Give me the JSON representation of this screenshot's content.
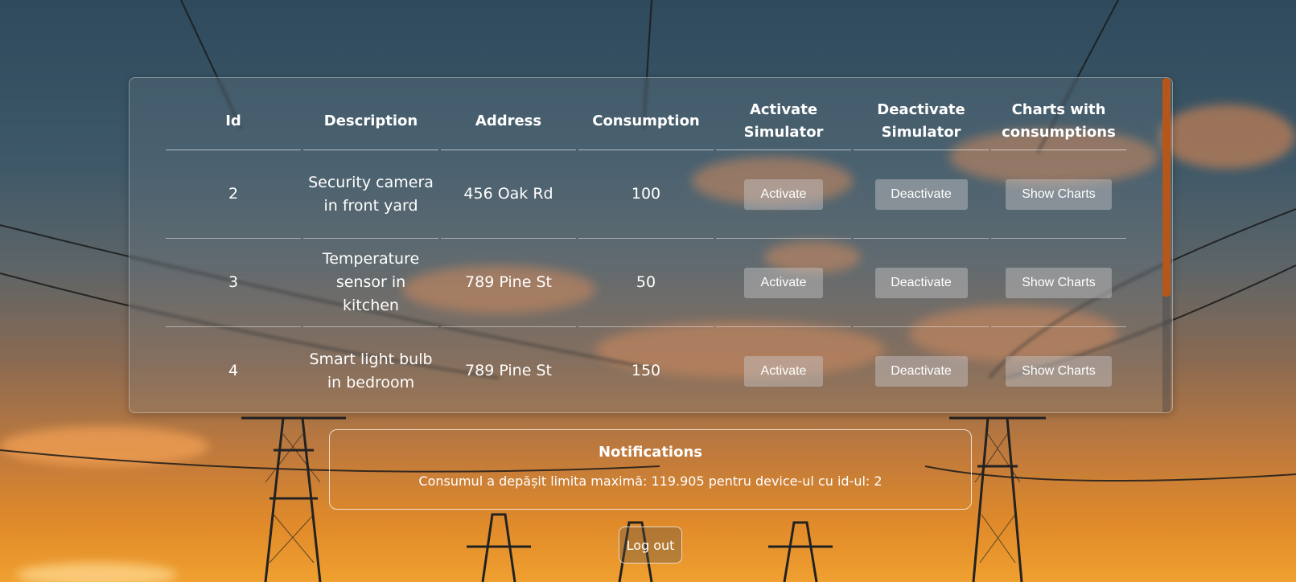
{
  "table": {
    "headers": {
      "id": "Id",
      "description": "Description",
      "address": "Address",
      "consumption": "Consumption",
      "activate_line1": "Activate",
      "activate_line2": "Simulator",
      "deactivate_line1": "Deactivate",
      "deactivate_line2": "Simulator",
      "charts_line1": "Charts with",
      "charts_line2": "consumptions"
    },
    "rows": [
      {
        "id": "2",
        "description": "Security camera in front yard",
        "address": "456 Oak Rd",
        "consumption": "100",
        "activate": "Activate",
        "deactivate": "Deactivate",
        "charts": "Show Charts"
      },
      {
        "id": "3",
        "description": "Temperature sensor in kitchen",
        "address": "789 Pine St",
        "consumption": "50",
        "activate": "Activate",
        "deactivate": "Deactivate",
        "charts": "Show Charts"
      },
      {
        "id": "4",
        "description": "Smart light bulb in bedroom",
        "address": "789 Pine St",
        "consumption": "150",
        "activate": "Activate",
        "deactivate": "Deactivate",
        "charts": "Show Charts"
      }
    ]
  },
  "notifications": {
    "title": "Notifications",
    "message": "Consumul a depășit limita maximă: 119.905 pentru device-ul cu id-ul: 2"
  },
  "logout_label": "Log out",
  "colors": {
    "scroll_thumb": "#b5561b",
    "sky_top": "#2e4a5c",
    "sunset": "#f0a030"
  }
}
